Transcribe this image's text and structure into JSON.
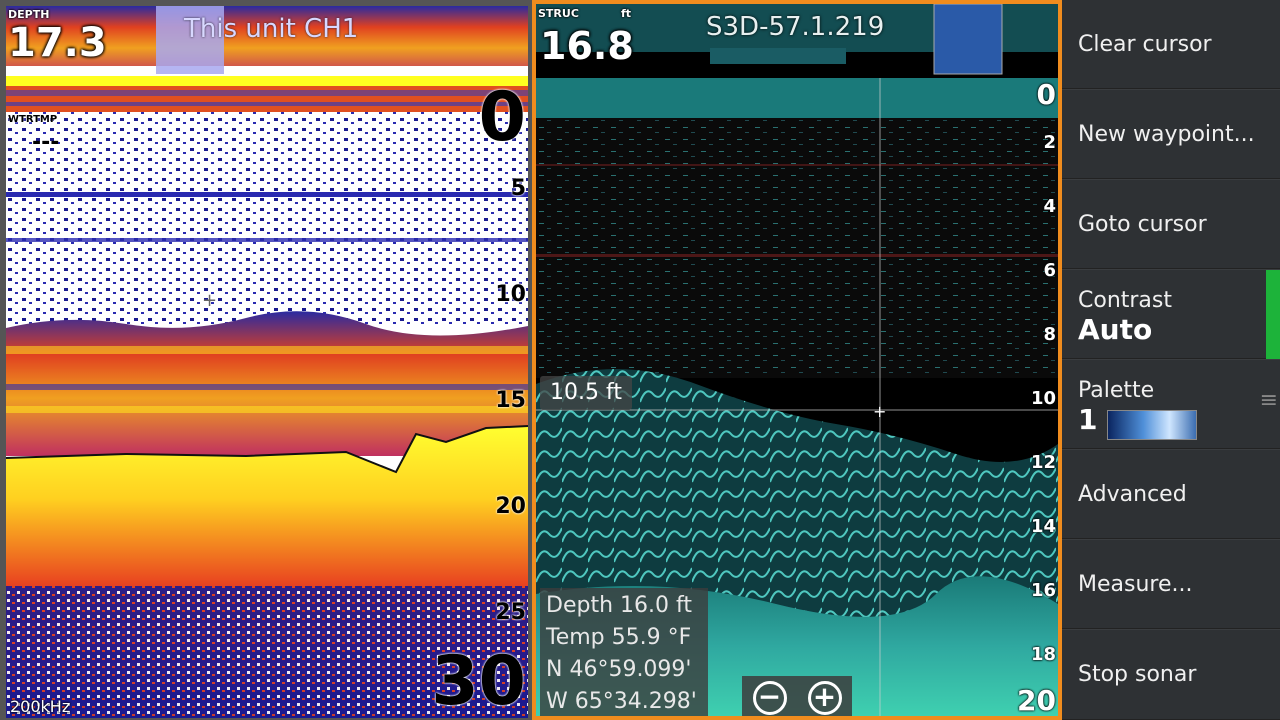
{
  "left_pane": {
    "depth_label": "DEPTH",
    "depth_value": "17.3",
    "unit_label": "This unit CH1",
    "wtmp_label": "WTRTMP",
    "wtmp_value": "---",
    "frequency": "200kHz",
    "scale": [
      "0",
      "5",
      "10",
      "15",
      "20",
      "25",
      "30"
    ]
  },
  "right_pane": {
    "struc_label": "STRUC",
    "unit": "ft",
    "depth_value": "16.8",
    "title": "S3D-57.1.219",
    "cursor_depth": "10.5 ft",
    "scale": [
      "0",
      "2",
      "4",
      "6",
      "8",
      "10",
      "12",
      "14",
      "16",
      "18",
      "20"
    ],
    "info": {
      "depth": "Depth 16.0  ft",
      "temp": "Temp  55.9 °F",
      "lat": "N  46°59.099'",
      "lon": "W 65°34.298'"
    },
    "zoom_out": "−",
    "zoom_in": "+"
  },
  "menu": {
    "clear_cursor": "Clear cursor",
    "new_waypoint": "New waypoint...",
    "goto_cursor": "Goto cursor",
    "contrast_label": "Contrast",
    "contrast_value": "Auto",
    "palette_label": "Palette",
    "palette_value": "1",
    "advanced": "Advanced",
    "measure": "Measure...",
    "stop_sonar": "Stop sonar"
  },
  "colors": {
    "accent_border": "#f08c1e",
    "contrast_active": "#1db33a",
    "menu_bg": "#2e3134"
  }
}
